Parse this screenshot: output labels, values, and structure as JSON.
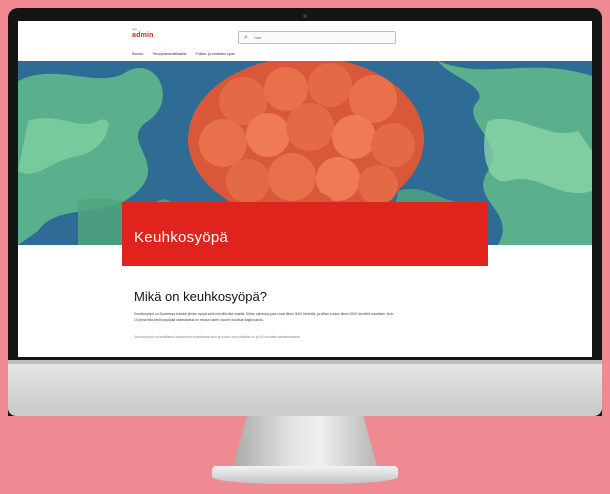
{
  "page": {
    "logo_small": "syo",
    "logo": "admin",
    "search_placeholder": "Hae",
    "nav": [
      "Etusivu",
      "Terveysammattilaisille",
      "Potilas- ja omaisten opas"
    ],
    "hero_title": "Keuhkosyöpä",
    "article_heading": "Mikä on keuhkosyöpä?",
    "para1_line1": "Keuhkosyöpä on Suomessa toiseksi yleisin syöpä sekä miehillä että naisilla. Siihen sairastuu joka vuosi lähes 3000 henkilöä, ja siihen kuolee lähes 2000 henkilöä vuosittain. Noin",
    "para1_line2": "15 prosenttia keuhkosyöpää sairastavista on elossa viiden vuoden kuluttua diagnoosista.",
    "para2": "Keuhkosyöpä on tavallisesti tupakoinnin aiheuttama tauti ja suurin osa potilaista on yli 60-vuotiaita sairastuessaan."
  },
  "colors": {
    "background": "#ef8a92",
    "accent_red": "#e0241d",
    "logo_red": "#d0231f"
  },
  "icons": [
    "search-icon"
  ]
}
